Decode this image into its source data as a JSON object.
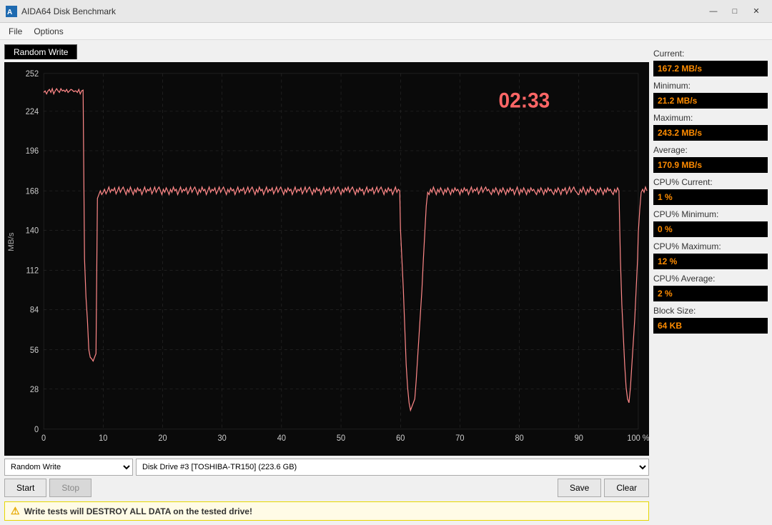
{
  "titlebar": {
    "title": "AIDA64 Disk Benchmark",
    "min_label": "—",
    "max_label": "□",
    "close_label": "✕"
  },
  "menu": {
    "file_label": "File",
    "options_label": "Options"
  },
  "tab": {
    "label": "Random Write"
  },
  "chart": {
    "timer": "02:33",
    "y_axis_label": "MB/s",
    "y_labels": [
      "252",
      "224",
      "196",
      "168",
      "140",
      "112",
      "84",
      "56",
      "28",
      "0"
    ],
    "x_labels": [
      "0",
      "10",
      "20",
      "30",
      "40",
      "50",
      "60",
      "70",
      "80",
      "90",
      "100 %"
    ]
  },
  "stats": {
    "current_label": "Current:",
    "current_value": "167.2 MB/s",
    "minimum_label": "Minimum:",
    "minimum_value": "21.2 MB/s",
    "maximum_label": "Maximum:",
    "maximum_value": "243.2 MB/s",
    "average_label": "Average:",
    "average_value": "170.9 MB/s",
    "cpu_current_label": "CPU% Current:",
    "cpu_current_value": "1 %",
    "cpu_minimum_label": "CPU% Minimum:",
    "cpu_minimum_value": "0 %",
    "cpu_maximum_label": "CPU% Maximum:",
    "cpu_maximum_value": "12 %",
    "cpu_average_label": "CPU% Average:",
    "cpu_average_value": "2 %",
    "block_size_label": "Block Size:",
    "block_size_value": "64 KB"
  },
  "controls": {
    "test_type": "Random Write",
    "drive": "Disk Drive #3  [TOSHIBA-TR150]  (223.6 GB)",
    "start_label": "Start",
    "stop_label": "Stop",
    "save_label": "Save",
    "clear_label": "Clear"
  },
  "warning": {
    "text": "Write tests will DESTROY ALL DATA on the tested drive!"
  }
}
